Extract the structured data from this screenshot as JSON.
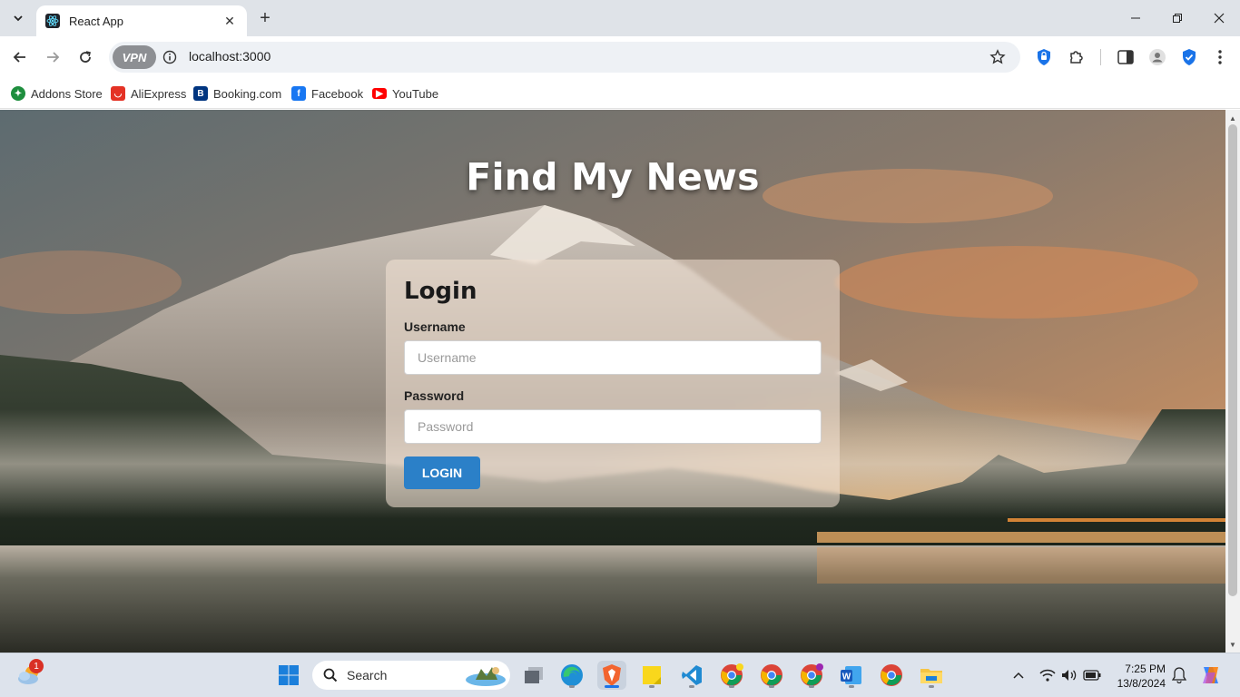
{
  "browser": {
    "tab_title": "React App",
    "url": "localhost:3000",
    "vpn_label": "VPN"
  },
  "bookmarks": [
    {
      "label": "Addons Store",
      "icon": "addons-icon",
      "color": "#1e8e3e"
    },
    {
      "label": "AliExpress",
      "icon": "aliexpress-icon",
      "color": "#e43225"
    },
    {
      "label": "Booking.com",
      "icon": "booking-icon",
      "color": "#003580"
    },
    {
      "label": "Facebook",
      "icon": "facebook-icon",
      "color": "#1877f2"
    },
    {
      "label": "YouTube",
      "icon": "youtube-icon",
      "color": "#ff0000"
    }
  ],
  "page": {
    "title": "Find My News",
    "login": {
      "heading": "Login",
      "username_label": "Username",
      "username_placeholder": "Username",
      "password_label": "Password",
      "password_placeholder": "Password",
      "submit_label": "LOGIN",
      "accent_color": "#2b80c8"
    }
  },
  "taskbar": {
    "search_label": "Search",
    "weather_badge": "1",
    "time": "7:25 PM",
    "date": "13/8/2024"
  }
}
